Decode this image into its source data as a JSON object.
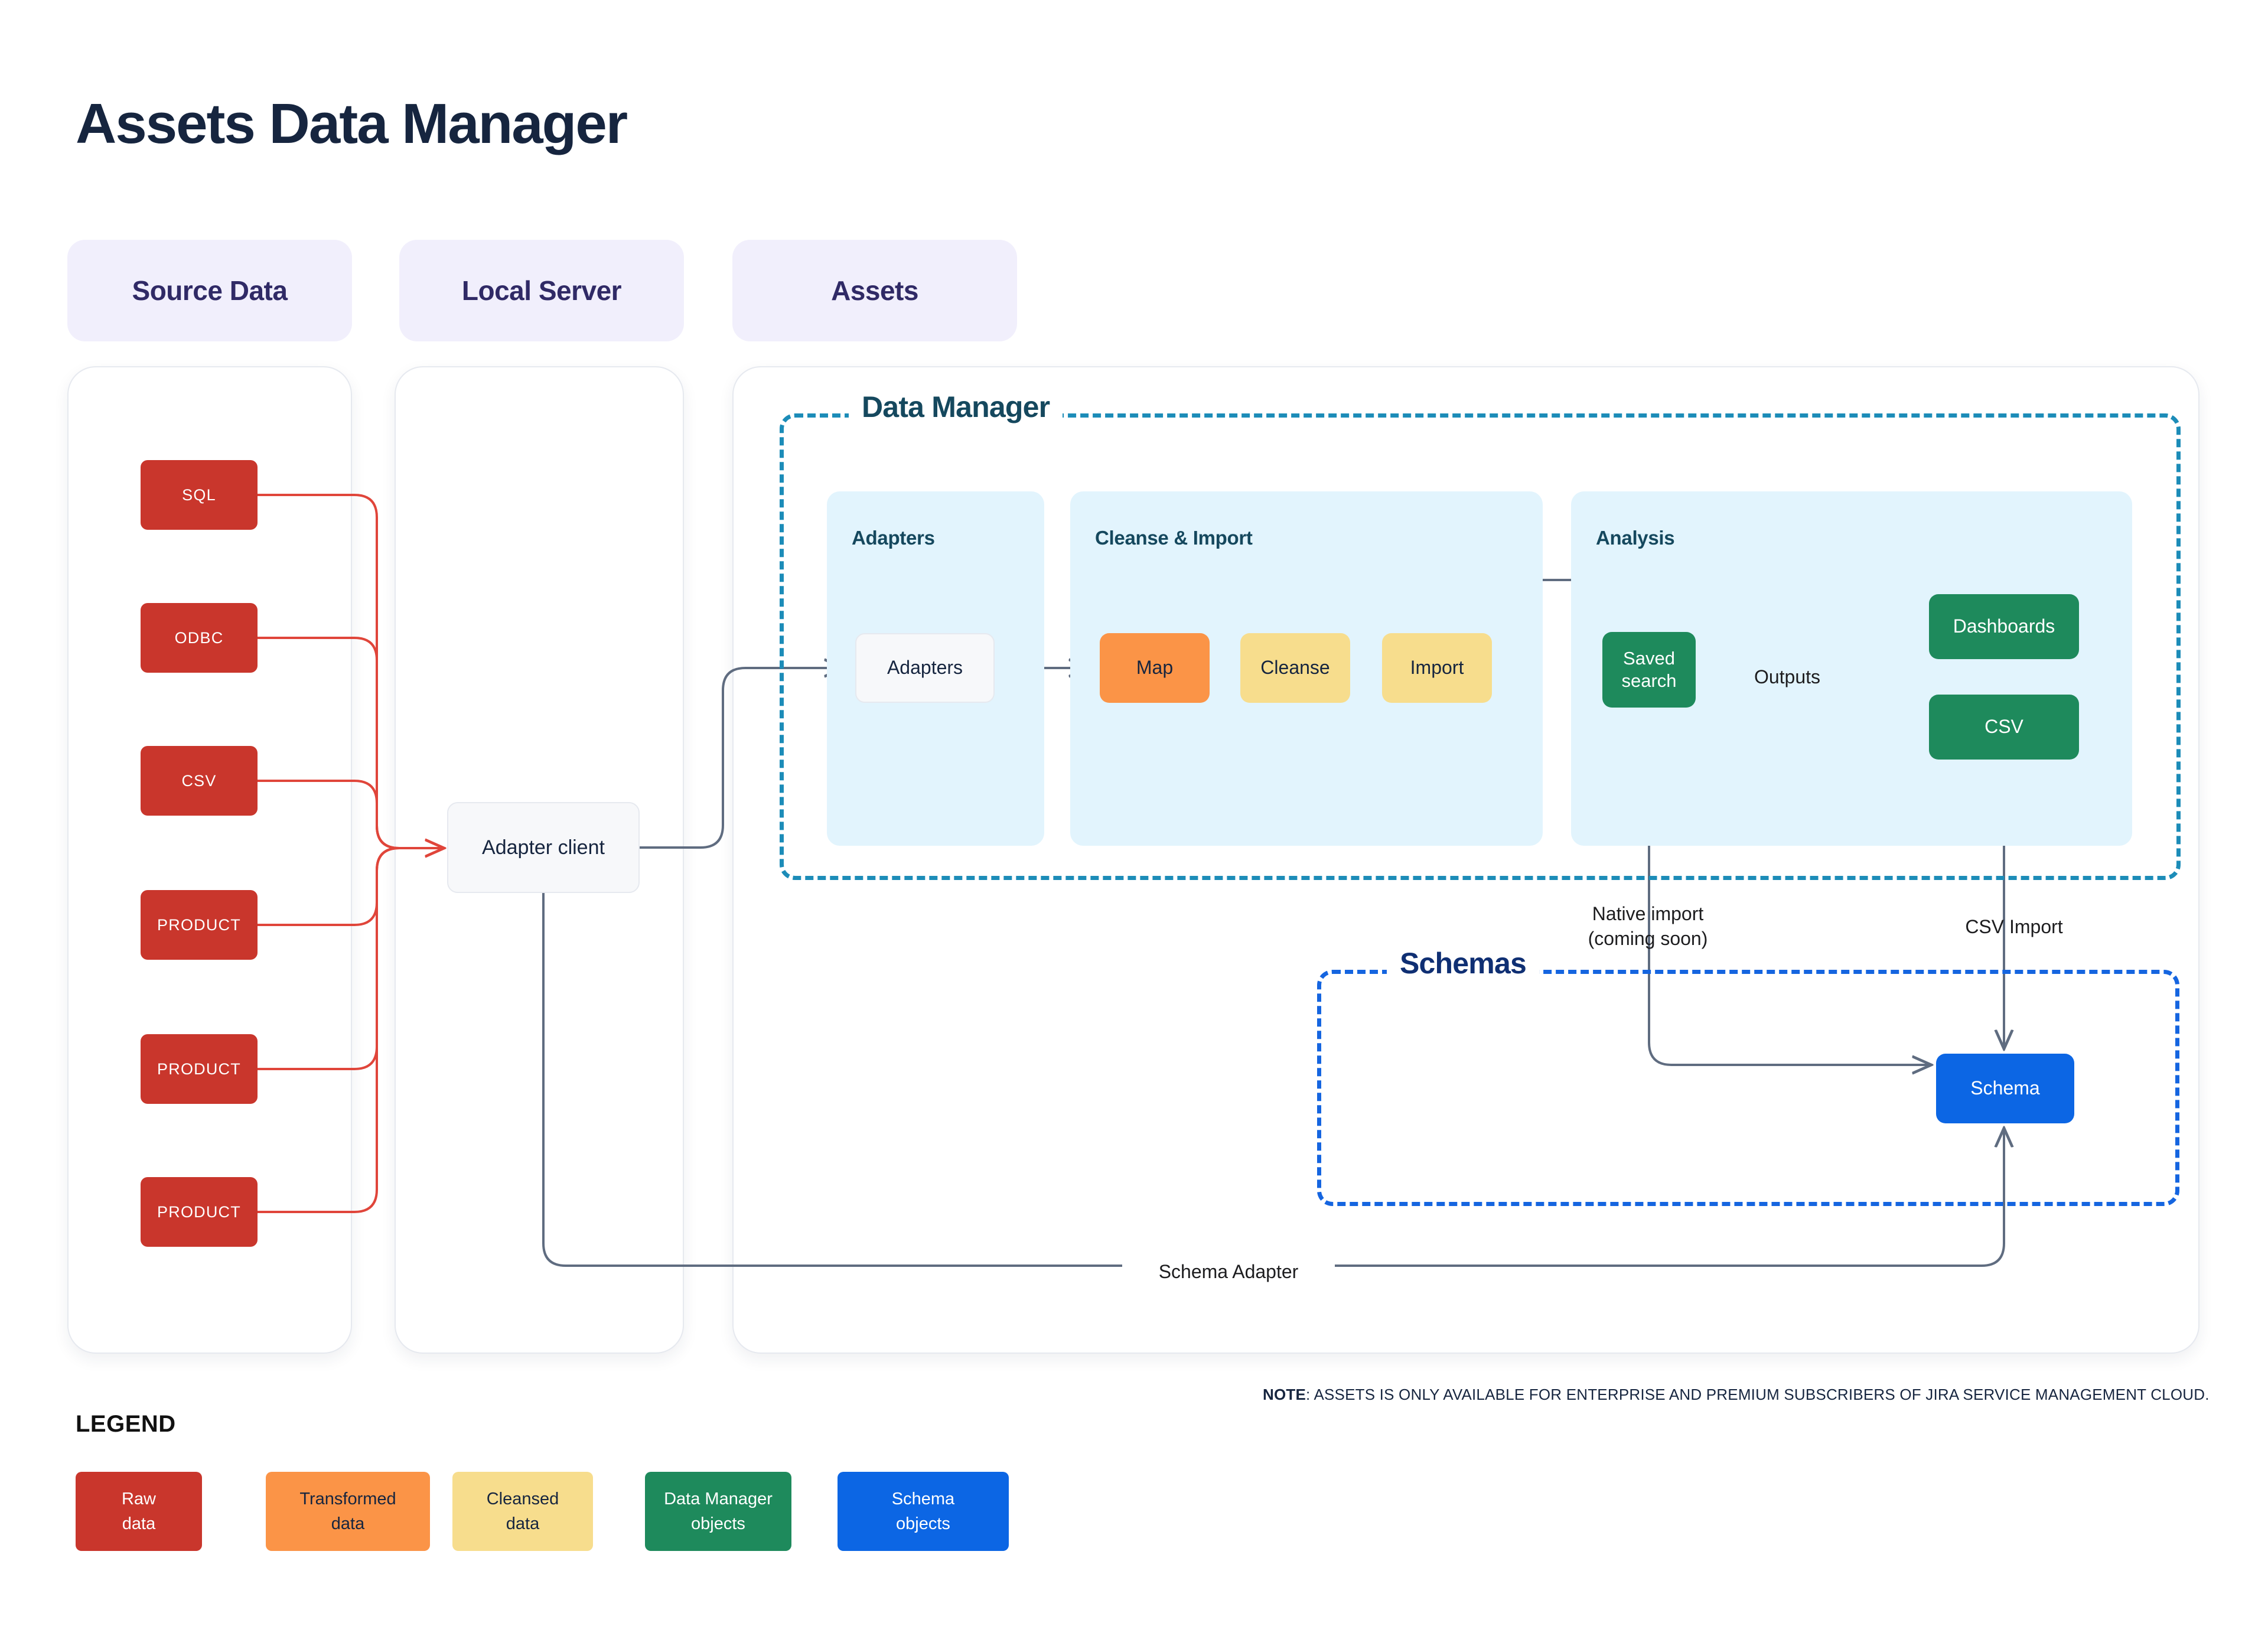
{
  "page": {
    "title": "Assets Data Manager"
  },
  "columns": [
    {
      "label": "Source Data"
    },
    {
      "label": "Local Server"
    },
    {
      "label": "Assets"
    }
  ],
  "source_data": {
    "items": [
      {
        "label": "SQL"
      },
      {
        "label": "ODBC"
      },
      {
        "label": "CSV"
      },
      {
        "label": "PRODUCT"
      },
      {
        "label": "PRODUCT"
      },
      {
        "label": "PRODUCT"
      }
    ]
  },
  "local_server": {
    "adapter_client": "Adapter client"
  },
  "data_manager": {
    "label": "Data Manager",
    "groups": [
      {
        "title": "Adapters",
        "nodes": [
          {
            "label": "Adapters"
          }
        ]
      },
      {
        "title": "Cleanse & Import",
        "nodes": [
          {
            "label": "Map"
          },
          {
            "label": "Cleanse"
          },
          {
            "label": "Import"
          }
        ]
      },
      {
        "title": "Analysis",
        "nodes": [
          {
            "label": "Saved\nsearch"
          },
          {
            "label": "Dashboards"
          },
          {
            "label": "CSV"
          }
        ],
        "edge_label": "Outputs"
      }
    ]
  },
  "schemas": {
    "label": "Schemas",
    "nodes": [
      {
        "label": "Schema"
      }
    ]
  },
  "edge_labels": {
    "outputs": "Outputs",
    "native_import": "Native import\n(coming soon)",
    "csv_import": "CSV Import",
    "schema_adapter": "Schema Adapter"
  },
  "note": {
    "prefix": "NOTE",
    "text": ": ASSETS IS ONLY AVAILABLE FOR ENTERPRISE AND PREMIUM SUBSCRIBERS OF JIRA SERVICE MANAGEMENT CLOUD."
  },
  "legend": {
    "title": "LEGEND",
    "items": [
      {
        "label": "Raw\ndata",
        "color": "#c9362c",
        "text_color": "#ffffff"
      },
      {
        "label": "Transformed\ndata",
        "color": "#fb9447",
        "text_color": "#16253f"
      },
      {
        "label": "Cleansed\ndata",
        "color": "#f7dd8d",
        "text_color": "#16253f"
      },
      {
        "label": "Data Manager\nobjects",
        "color": "#1e8a5c",
        "text_color": "#ffffff"
      },
      {
        "label": "Schema\nobjects",
        "color": "#0c66e4",
        "text_color": "#ffffff"
      }
    ]
  },
  "colors": {
    "raw": "#c9362c",
    "transformed": "#fb9447",
    "cleansed": "#f7dd8d",
    "dm_object": "#1e8a5c",
    "schema_object": "#0c66e4",
    "dm_dash": "#1c8cb8",
    "schema_dash": "#1565e0",
    "group_bg": "#e2f4fd",
    "pill_bg": "#f1effc",
    "pill_text": "#302a66",
    "title_text": "#16253f",
    "wire_red": "#e0453a",
    "wire_gray": "#5f6c80"
  }
}
